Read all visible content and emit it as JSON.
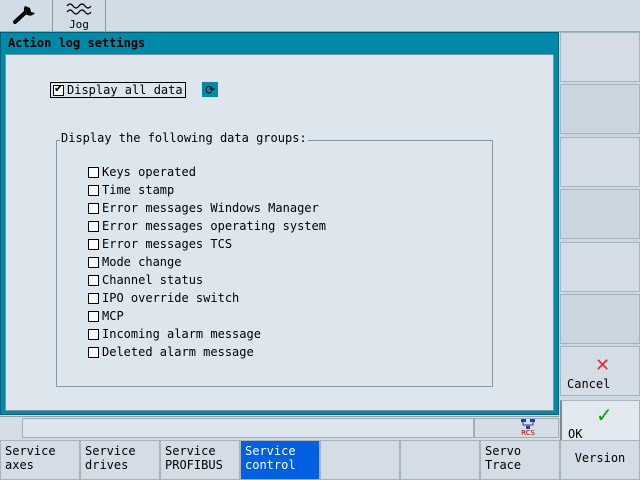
{
  "topbar": {
    "wrench_icon": "wrench-icon",
    "jog_label": "Jog",
    "jog_icon": "wave-icon"
  },
  "dialog": {
    "title": "Action log settings",
    "display_all": {
      "label": "Display all data",
      "checked": true
    },
    "group_label": "Display the following data groups:",
    "items": [
      {
        "label": "Keys operated",
        "checked": false
      },
      {
        "label": "Time stamp",
        "checked": false
      },
      {
        "label": "Error messages Windows Manager",
        "checked": false
      },
      {
        "label": "Error messages operating system",
        "checked": false
      },
      {
        "label": "Error messages TCS",
        "checked": false
      },
      {
        "label": "Mode change",
        "checked": false
      },
      {
        "label": "Channel status",
        "checked": false
      },
      {
        "label": "IPO override switch",
        "checked": false
      },
      {
        "label": "MCP",
        "checked": false
      },
      {
        "label": "Incoming alarm message",
        "checked": false
      },
      {
        "label": "Deleted alarm message",
        "checked": false
      }
    ]
  },
  "right_softkeys": {
    "cancel_label": "Cancel",
    "ok_label": "OK"
  },
  "status": {
    "rcs_label": "RCS"
  },
  "bottom_softkeys": [
    {
      "line1": "Service",
      "line2": "axes"
    },
    {
      "line1": "Service",
      "line2": "drives"
    },
    {
      "line1": "Service",
      "line2": "PROFIBUS"
    },
    {
      "line1": "Service",
      "line2": "control",
      "active": true
    },
    {
      "line1": "",
      "line2": ""
    },
    {
      "line1": "",
      "line2": ""
    },
    {
      "line1": "Servo",
      "line2": "Trace"
    },
    {
      "line1": "Version",
      "line2": ""
    }
  ],
  "colors": {
    "dialog_frame": "#008aa8",
    "active_softkey": "#0060e0",
    "cancel_icon": "#ff2020",
    "ok_icon": "#08a010"
  }
}
